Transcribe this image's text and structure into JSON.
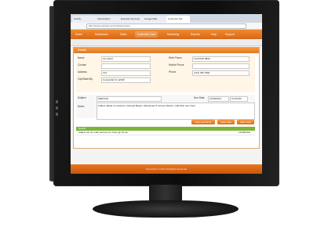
{
  "browser": {
    "tabs": [
      "Hostify",
      "Subscription",
      "Example Services",
      "Google Mail",
      "Customer Det"
    ],
    "url": "http://www.example.com/customer/view"
  },
  "nav": {
    "items": [
      "Home",
      "Dashboard",
      "Sales",
      "Customer Care",
      "Marketing",
      "Reports",
      "Help",
      "Support"
    ],
    "active_index": 3
  },
  "panel": {
    "title": "Details",
    "fields": {
      "name_label": "Name",
      "name_value": "Jim Ward",
      "contact_label": "Contact",
      "contact_value": "",
      "address_label": "Address",
      "address_value": "123",
      "city_label": "City/State/Zip",
      "city_value": "Centerville FL 12345",
      "ref_label": "Ref# Phone",
      "ref_value": "CUST007 8844",
      "mobile_label": "Mobile Phone",
      "mobile_value": "",
      "phone_label": "Phone",
      "phone_value": "(123) 456 7890"
    },
    "subject_label": "Subject",
    "subject_value": "SERVICE",
    "due_label": "Due Date",
    "due_value": "12/09/2014",
    "time_value": "10:00 AM",
    "notes_label": "Notes",
    "notes_value": "Called. talked to customer. Ordered Beans. Mentioned IT Access District. Call back next Tues.",
    "buttons": [
      "Save and Send",
      "Save Task",
      "Save Note"
    ],
    "grid_header": "Details",
    "grid_rows": [
      {
        "text": "Called, set up order and sent to Tracy @ 10 am",
        "date": "12/08/2014"
      }
    ]
  },
  "footer": {
    "text": "ServicePro © 2014 All Rights Reserved"
  }
}
